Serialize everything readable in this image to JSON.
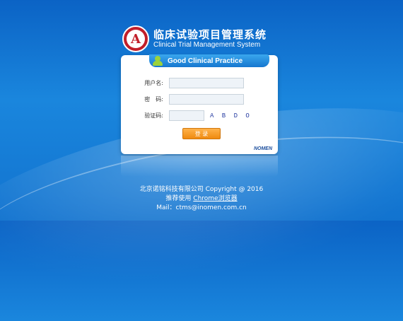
{
  "header": {
    "title_cn": "临床试验项目管理系统",
    "title_en": "Clinical Trial Management System",
    "logo_letter": "A"
  },
  "panel": {
    "ribbon_title": "Good Clinical Practice",
    "username_label": "用户名:",
    "password_label": "密　码:",
    "captcha_label": "验证码:",
    "captcha_text": "A B D O",
    "login_label": "登 录",
    "brand": "NOMEN"
  },
  "fields": {
    "username_value": "",
    "password_value": "",
    "captcha_value": ""
  },
  "footer": {
    "copyright": "北京诺铭科技有限公司 Copyright @ 2016",
    "recommend_prefix": "推荐使用 ",
    "recommend_link": "Chrome浏览器",
    "mail": "Mail：ctms@inomen.com.cn"
  },
  "colors": {
    "background": "#1273cf",
    "ribbon": "#1677cf",
    "login_button": "#ef8a10",
    "logo": "#c21f2a"
  }
}
